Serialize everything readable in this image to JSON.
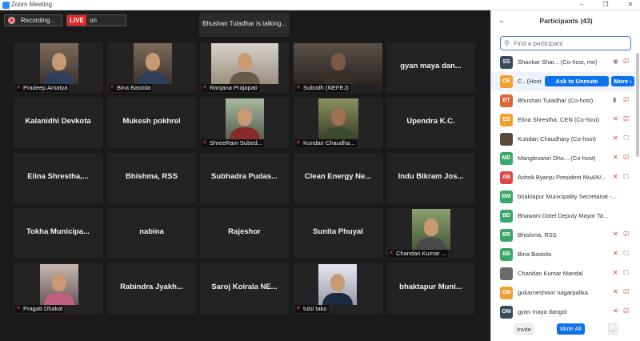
{
  "window": {
    "title": "Zoom Meeting",
    "minimize_icon": "minimize-icon",
    "maximize_icon": "maximize-icon",
    "close_icon": "close-icon"
  },
  "toolbar": {
    "recording_label": "Recording...",
    "live_tag": "LIVE",
    "live_label": "on Facebook"
  },
  "talking_banner": "Bhushan Tuladhar is talking...",
  "grid": {
    "r1": {
      "c1": "Pradeep Amatya",
      "c2": "Bina Bastola",
      "c3": "Ranjana Prajapati",
      "c4": "Subodh (NEFEJ)",
      "c5": "gyan maya dan..."
    },
    "r2": {
      "c1": "Kalanidhi Devkota",
      "c2": "Mukesh pokhrel",
      "c3": "ShreeRam Subed...",
      "c4": "Kundan Chaudha...",
      "c5": "Upendra K.C."
    },
    "r3": {
      "c1": "Elina  Shrestha,...",
      "c2": "Bhishma, RSS",
      "c3": "Subhadra  Pudas...",
      "c4": "Clean  Energy  Ne...",
      "c5": "Indu Bikram Jos..."
    },
    "r4": {
      "c1": "Tokha  Municipa...",
      "c2": "nabina",
      "c3": "Rajeshor",
      "c4": "Sunita Phuyal",
      "c5": "Chandan Kumar ..."
    },
    "r5": {
      "c1": "Pragati Dhakal",
      "c2": "Rabindra  Jyakh...",
      "c3": "Saroj Koirala  NE...",
      "c4": "tulsi tako",
      "c5": "bhaktapur  Muni..."
    }
  },
  "panel": {
    "title": "Participants (43)",
    "search_placeholder": "Find a participant",
    "ask_unmute": "Ask to Unmute",
    "more": "More",
    "participants": {
      "p1": {
        "initials": "SS",
        "name": "Shankar Shar... (Co-host, me)",
        "color": "#3c4a5a"
      },
      "p2": {
        "initials": "CE",
        "name": "C.. (Host)",
        "color": "#f0a030"
      },
      "p3": {
        "initials": "BT",
        "name": "Bhushan Tuladhar (Co-host)",
        "color": "#e0643a"
      },
      "p4": {
        "initials": "ES",
        "name": "Elina Shrestha, CEN (Co-host)",
        "color": "#f0a030"
      },
      "p5": {
        "initials": "",
        "name": "Kundan Chaudhary (Co-host)",
        "color": "#5a4a3a"
      },
      "p6": {
        "initials": "MD",
        "name": "Mangleswori Dho... (Co-host)",
        "color": "#3aa86a"
      },
      "p7": {
        "initials": "AB",
        "name": "Ashok Byanju President MuAN/...",
        "color": "#e04848"
      },
      "p8": {
        "initials": "BM",
        "name": "bhaktapur Municipality Secretariat -...",
        "color": "#3aa86a"
      },
      "p9": {
        "initials": "BD",
        "name": "Bhawani Dotel Deputy Mayor Ta...",
        "color": "#3aa86a"
      },
      "p10": {
        "initials": "BR",
        "name": "Bhishma, RSS",
        "color": "#3aa86a"
      },
      "p11": {
        "initials": "BB",
        "name": "Bina Bastola",
        "color": "#3aa86a"
      },
      "p12": {
        "initials": "",
        "name": "Chandan Kumar Mandal",
        "color": "#6a6a6a"
      },
      "p13": {
        "initials": "GN",
        "name": "gokarneshwor nagarpalika",
        "color": "#f0a030"
      },
      "p14": {
        "initials": "GM",
        "name": "gyan maya dangol",
        "color": "#3c4a5a"
      }
    },
    "invite": "Invite",
    "mute_all": "Mute All",
    "more_dots": "..."
  }
}
